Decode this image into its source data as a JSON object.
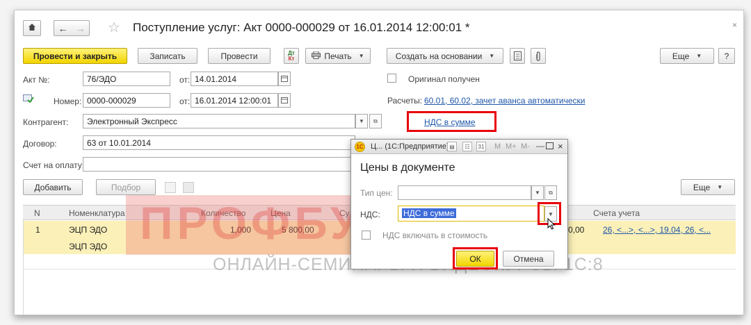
{
  "window": {
    "title": "Поступление услуг: Акт 0000-000029 от 16.01.2014 12:00:01 *",
    "nav": {
      "home_icon": "home-icon",
      "back_icon": "arrow-left-icon",
      "forward_icon": "arrow-right-icon",
      "star_icon": "star-icon"
    }
  },
  "toolbar": {
    "post_close": "Провести и закрыть",
    "save": "Записать",
    "post": "Провести",
    "print": "Печать",
    "create_based": "Создать на основании",
    "more": "Еще",
    "help": "?"
  },
  "form": {
    "act_no_label": "Акт №:",
    "act_no_value": "76/ЭДО",
    "act_date_label": "от:",
    "act_date_value": "14.01.2014",
    "number_label": "Номер:",
    "number_value": "0000-000029",
    "number_date_label": "от:",
    "number_date_value": "16.01.2014 12:00:01",
    "original_label": "Оригинал получен",
    "calc_label": "Расчеты:",
    "calc_link": "60.01, 60.02, зачет аванса автоматически",
    "vat_link": "НДС в сумме",
    "contractor_label": "Контрагент:",
    "contractor_value": "Электронный Экспресс",
    "contract_label": "Договор:",
    "contract_value": "63 от 10.01.2014",
    "invoice_label": "Счет на оплату:",
    "invoice_value": ""
  },
  "table_toolbar": {
    "add": "Добавить",
    "pick": "Подбор",
    "more": "Еще"
  },
  "table": {
    "headers": [
      "N",
      "Номенклатура",
      "Количество",
      "Цена",
      "Су",
      "Счета учета"
    ],
    "rows": [
      {
        "n": "1",
        "item": "ЭЦП ЭДО",
        "qty": "1,000",
        "price": "5 800,00",
        "sum_tail": "0,00",
        "accounts": "26, <...>, <...>, 19.04, 26, <..."
      }
    ],
    "subrow_item": "ЭЦП ЭДО"
  },
  "dialog": {
    "app_title": "Ц... (1С:Предприятие)",
    "toolbar_text": [
      "M",
      "M+",
      "M-"
    ],
    "heading": "Цены в документе",
    "price_type_label": "Тип цен:",
    "price_type_value": "",
    "vat_label": "НДС:",
    "vat_value": "НДС в сумме",
    "vat_include_label": "НДС включать в стоимость",
    "ok": "ОК",
    "cancel": "Отмена"
  },
  "watermark": {
    "brand": "ПРОФБУХ8.ру",
    "tagline": "ОНЛАЙН-СЕМИНАРЫ И ВИДЕОКУРСЫ 1С:8"
  },
  "colors": {
    "accent_yellow": "#f2d500",
    "link_blue": "#1e56a8",
    "highlight_red": "#e8000a",
    "row_highlight": "#fbf0b8",
    "selection_blue": "#3d6bd8"
  }
}
